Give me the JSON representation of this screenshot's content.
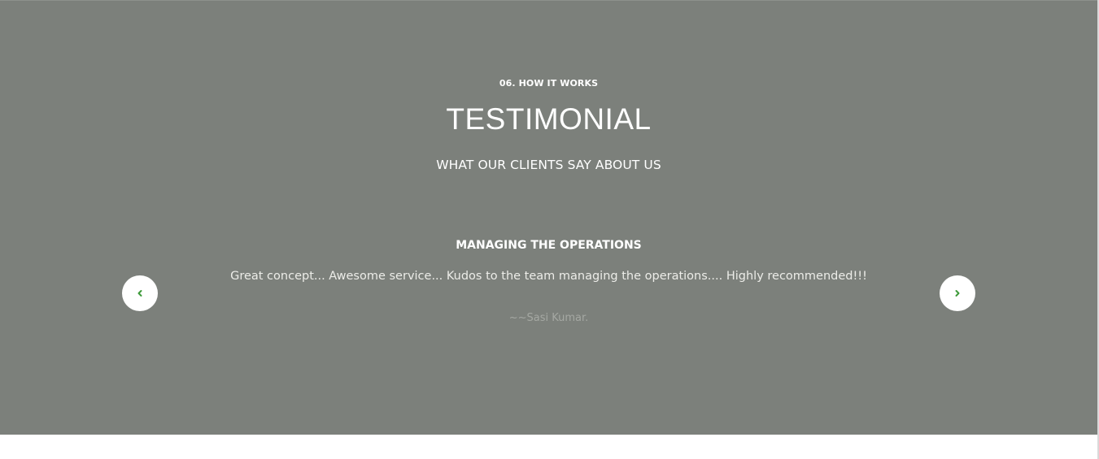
{
  "testimonials": {
    "eyebrow": "06. HOW IT WORKS",
    "title": "TESTIMONIAL",
    "subtitle": "WHAT OUR CLIENTS SAY ABOUT US",
    "slide": {
      "heading": "MANAGING THE OPERATIONS",
      "text": "Great concept... Awesome service... Kudos to the team managing the operations.... Highly recommended!!!",
      "author": "~~Sasi Kumar."
    },
    "controls": {
      "prev_icon": "chevron-left-icon",
      "next_icon": "chevron-right-icon",
      "icon_color": "#3e9a3a"
    },
    "colors": {
      "background": "#7c807b",
      "text": "#ffffff"
    }
  }
}
